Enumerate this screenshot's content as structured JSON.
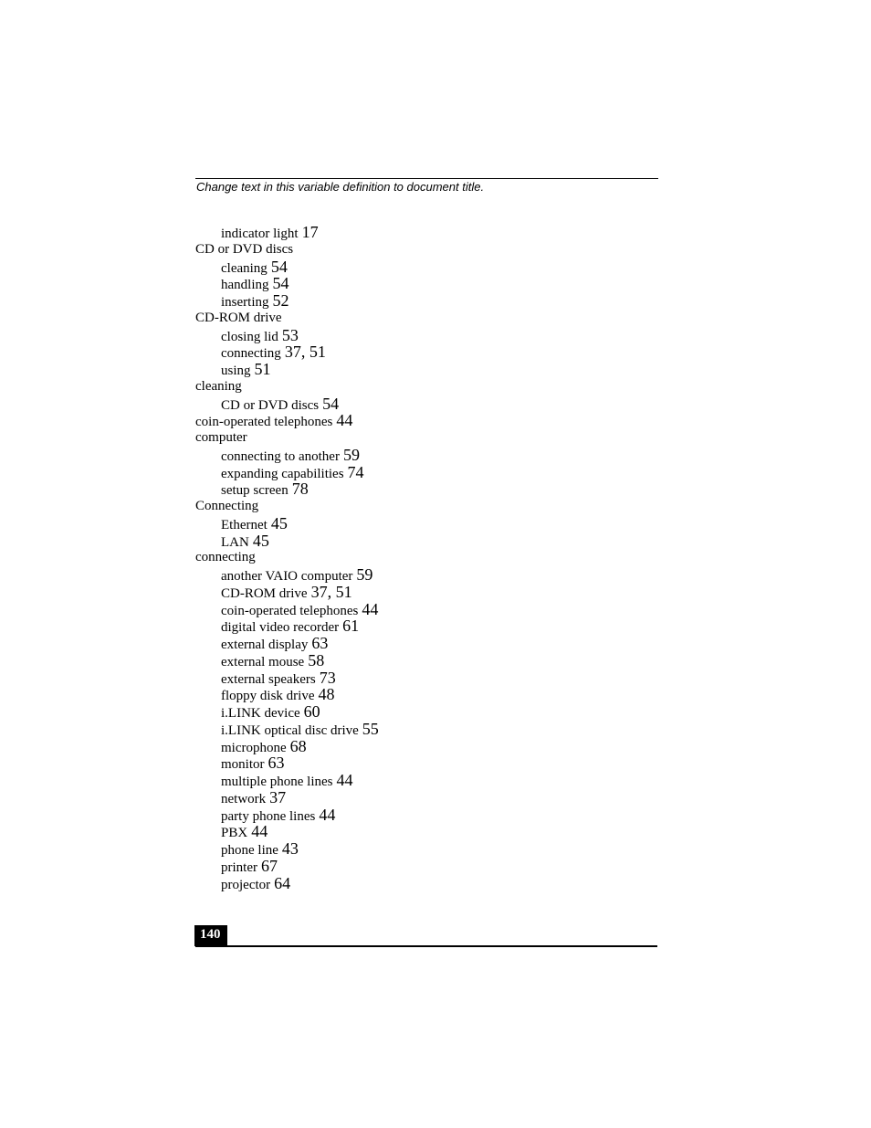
{
  "header": {
    "title": "Change text in this variable definition to document title."
  },
  "index": [
    {
      "level": 2,
      "term": "indicator light",
      "pages": "17"
    },
    {
      "level": 1,
      "term": "CD or DVD discs",
      "pages": ""
    },
    {
      "level": 2,
      "term": "cleaning",
      "pages": "54"
    },
    {
      "level": 2,
      "term": "handling",
      "pages": "54"
    },
    {
      "level": 2,
      "term": "inserting",
      "pages": "52"
    },
    {
      "level": 1,
      "term": "CD-ROM drive",
      "pages": ""
    },
    {
      "level": 2,
      "term": "closing lid",
      "pages": "53"
    },
    {
      "level": 2,
      "term": "connecting",
      "pages": "37, 51"
    },
    {
      "level": 2,
      "term": "using",
      "pages": "51"
    },
    {
      "level": 1,
      "term": "cleaning",
      "pages": ""
    },
    {
      "level": 2,
      "term": "CD or DVD discs",
      "pages": "54"
    },
    {
      "level": 1,
      "term": "coin-operated telephones",
      "pages": "44"
    },
    {
      "level": 1,
      "term": "computer",
      "pages": ""
    },
    {
      "level": 2,
      "term": "connecting to another",
      "pages": "59"
    },
    {
      "level": 2,
      "term": "expanding capabilities",
      "pages": "74"
    },
    {
      "level": 2,
      "term": "setup screen",
      "pages": "78"
    },
    {
      "level": 1,
      "term": "Connecting",
      "pages": ""
    },
    {
      "level": 2,
      "term": "Ethernet",
      "pages": "45"
    },
    {
      "level": 2,
      "term": "LAN",
      "pages": "45"
    },
    {
      "level": 1,
      "term": "connecting",
      "pages": ""
    },
    {
      "level": 2,
      "term": "another VAIO computer",
      "pages": "59"
    },
    {
      "level": 2,
      "term": "CD-ROM drive",
      "pages": "37, 51"
    },
    {
      "level": 2,
      "term": "coin-operated telephones",
      "pages": "44"
    },
    {
      "level": 2,
      "term": "digital video recorder",
      "pages": "61"
    },
    {
      "level": 2,
      "term": "external display",
      "pages": "63"
    },
    {
      "level": 2,
      "term": "external mouse",
      "pages": "58"
    },
    {
      "level": 2,
      "term": "external speakers",
      "pages": "73"
    },
    {
      "level": 2,
      "term": "floppy disk drive",
      "pages": "48"
    },
    {
      "level": 2,
      "term": "i.LINK device",
      "pages": "60"
    },
    {
      "level": 2,
      "term": "i.LINK optical disc drive",
      "pages": "55"
    },
    {
      "level": 2,
      "term": "microphone",
      "pages": "68"
    },
    {
      "level": 2,
      "term": "monitor",
      "pages": "63"
    },
    {
      "level": 2,
      "term": "multiple phone lines",
      "pages": "44"
    },
    {
      "level": 2,
      "term": "network",
      "pages": "37"
    },
    {
      "level": 2,
      "term": "party phone lines",
      "pages": "44"
    },
    {
      "level": 2,
      "term": "PBX",
      "pages": "44"
    },
    {
      "level": 2,
      "term": "phone line",
      "pages": "43"
    },
    {
      "level": 2,
      "term": "printer",
      "pages": "67"
    },
    {
      "level": 2,
      "term": "projector",
      "pages": "64"
    }
  ],
  "footer": {
    "page_number": "140"
  }
}
